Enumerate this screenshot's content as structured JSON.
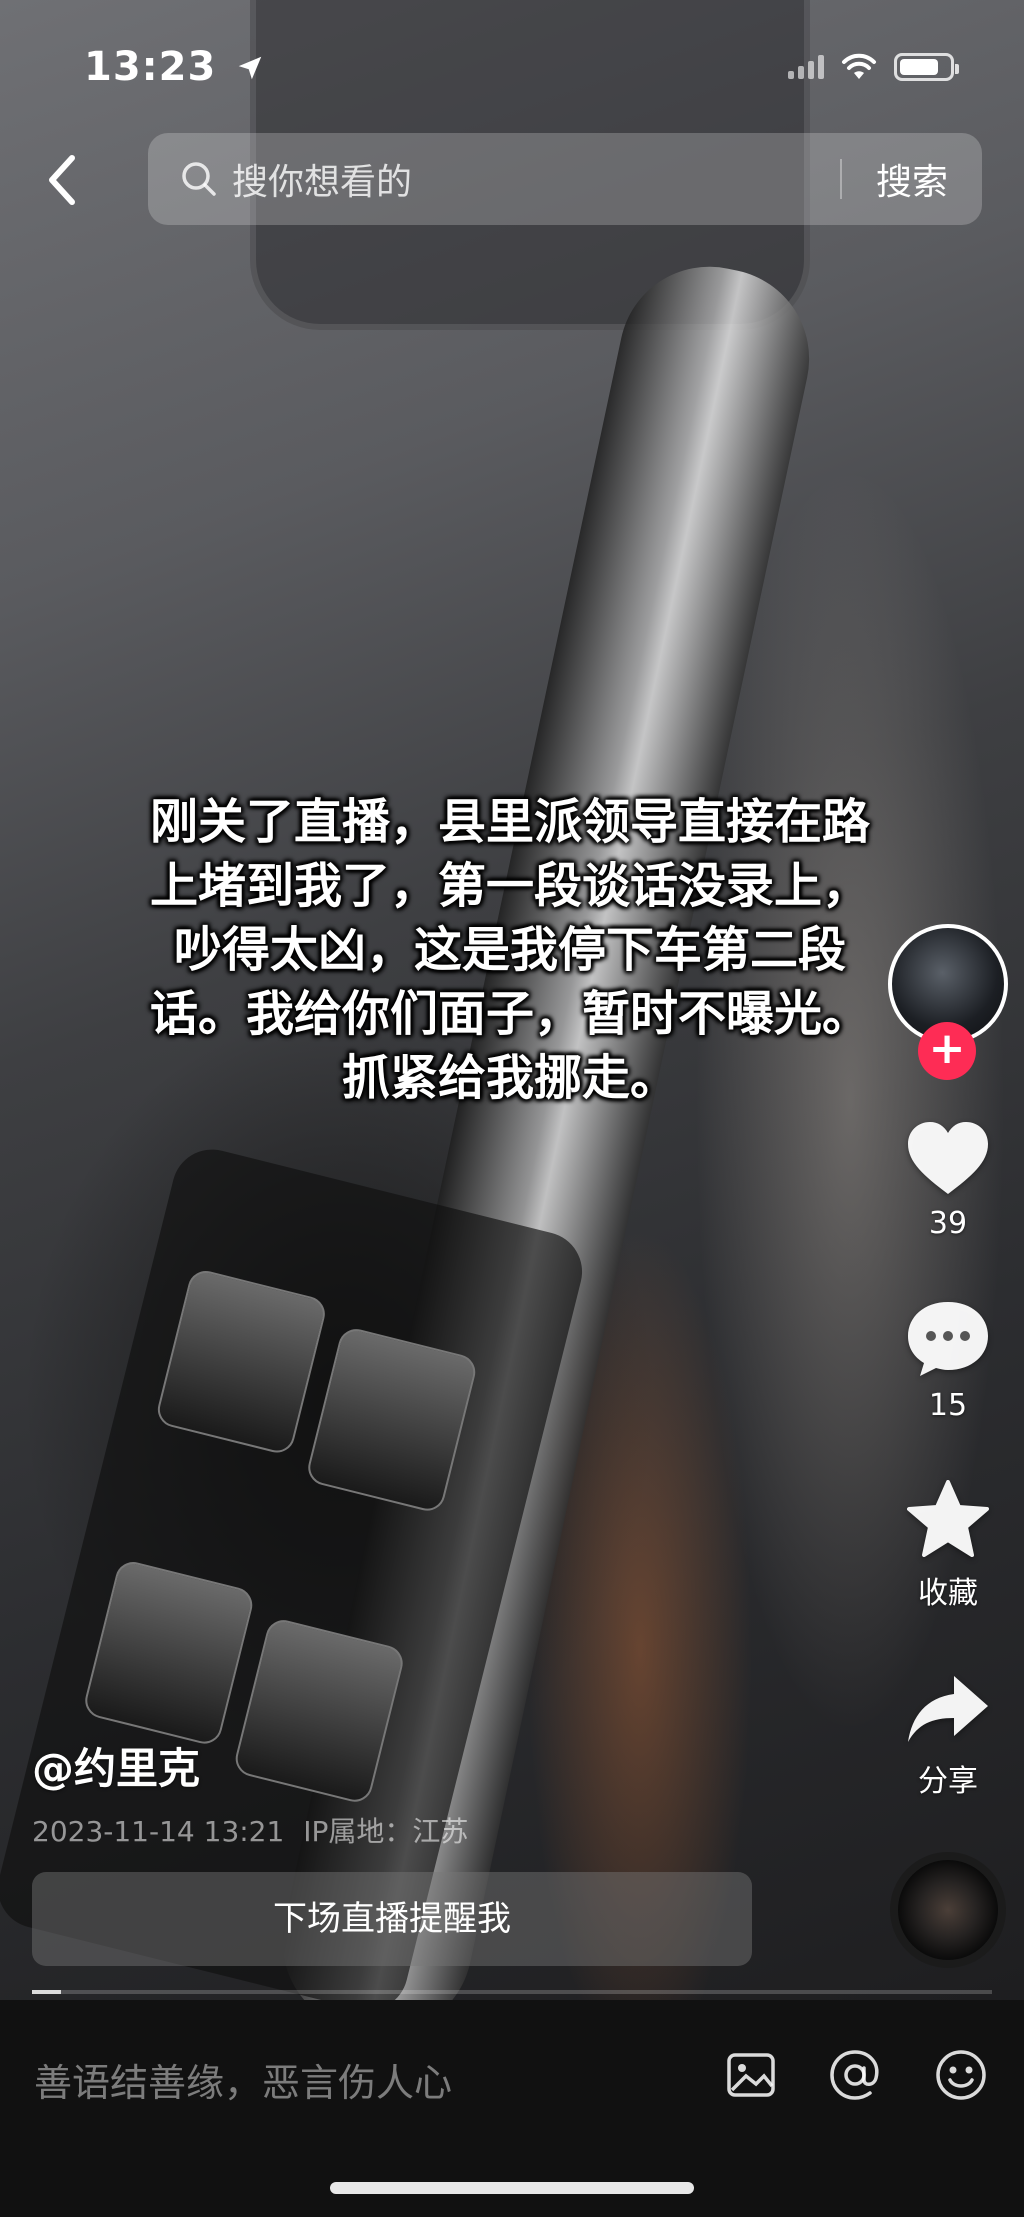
{
  "status": {
    "time": "13:23"
  },
  "search": {
    "placeholder": "搜你想看的",
    "button": "搜索"
  },
  "caption": {
    "lines": [
      "刚关了直播，县里派领导直接在路",
      "上堵到我了，第一段谈话没录上，",
      "吵得太凶，这是我停下车第二段",
      "话。我给你们面子，暂时不曝光。",
      "抓紧给我挪走。"
    ]
  },
  "actions": {
    "like_count": "39",
    "comment_count": "15",
    "favorite_label": "收藏",
    "share_label": "分享"
  },
  "post": {
    "author": "@约里克",
    "timestamp": "2023-11-14 13:21",
    "ip_location": "IP属地：江苏",
    "live_remind_label": "下场直播提醒我"
  },
  "comment_bar": {
    "placeholder": "善语结善缘，恶言伤人心"
  },
  "colors": {
    "follow": "#fe2c55",
    "background": "#000000"
  },
  "icons": [
    "location-arrow-icon",
    "signal-icon",
    "wifi-icon",
    "battery-icon",
    "back-icon",
    "search-icon",
    "plus-icon",
    "heart-icon",
    "comment-icon",
    "star-icon",
    "share-icon",
    "image-icon",
    "at-icon",
    "emoji-icon"
  ]
}
